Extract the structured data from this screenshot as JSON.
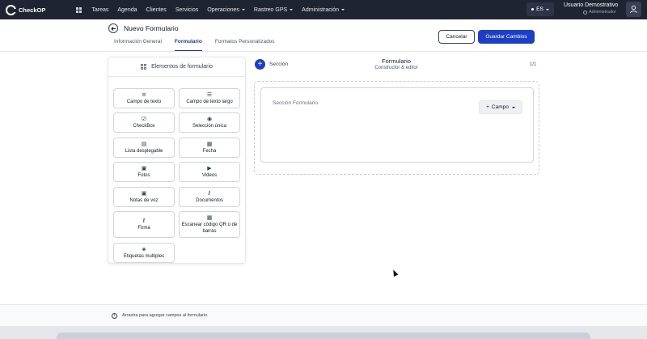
{
  "app": {
    "brand": "CheckOP"
  },
  "topnav": {
    "menu": [
      {
        "label": "Tareas",
        "dropdown": false
      },
      {
        "label": "Agenda",
        "dropdown": false
      },
      {
        "label": "Clientes",
        "dropdown": false
      },
      {
        "label": "Servicios",
        "dropdown": false
      },
      {
        "label": "Operaciones",
        "dropdown": true
      },
      {
        "label": "Rastreo GPS",
        "dropdown": true
      },
      {
        "label": "Administración",
        "dropdown": true
      }
    ],
    "language": "ES",
    "user": {
      "name": "Usuario Demostrativo",
      "role": "Administrador"
    }
  },
  "header": {
    "title": "Nuevo Formulario",
    "tabs": [
      {
        "label": "Información General",
        "active": false
      },
      {
        "label": "Formulario",
        "active": true
      },
      {
        "label": "Formatos Personalizados",
        "active": false
      }
    ],
    "cancel_label": "Cancelar",
    "save_label": "Guardar Cambios"
  },
  "elements_panel": {
    "title": "Elementos de formulario",
    "items": [
      {
        "label": "Campo de texto",
        "icon": "short-text-icon"
      },
      {
        "label": "Campo de texto largo",
        "icon": "long-text-icon"
      },
      {
        "label": "CheckBox",
        "icon": "checkbox-icon"
      },
      {
        "label": "Selección única",
        "icon": "radio-icon"
      },
      {
        "label": "Lista desplegable",
        "icon": "dropdown-list-icon"
      },
      {
        "label": "Fecha",
        "icon": "calendar-icon"
      },
      {
        "label": "Fotos",
        "icon": "image-icon"
      },
      {
        "label": "Videos",
        "icon": "video-icon"
      },
      {
        "label": "Notas de voz",
        "icon": "voice-note-icon"
      },
      {
        "label": "Documentos",
        "icon": "paperclip-icon"
      },
      {
        "label": "Firma",
        "icon": "signature-icon"
      },
      {
        "label": "Escanear código QR o de barras",
        "icon": "qr-code-icon"
      },
      {
        "label": "Etiquetas multiples",
        "icon": "tag-icon"
      }
    ]
  },
  "builder": {
    "section_label": "Sección",
    "title": "Formulario",
    "subtitle": "Constructor & editor",
    "pager": "1/1",
    "section_name": "Sección Formulario",
    "add_field_label": "Campo"
  },
  "footer": {
    "hint": "Arrastra para agregar campos al formulario."
  },
  "colors": {
    "nav_bg": "#1f2433",
    "primary": "#1d3fc4",
    "tab_active": "#1e3a8a"
  }
}
